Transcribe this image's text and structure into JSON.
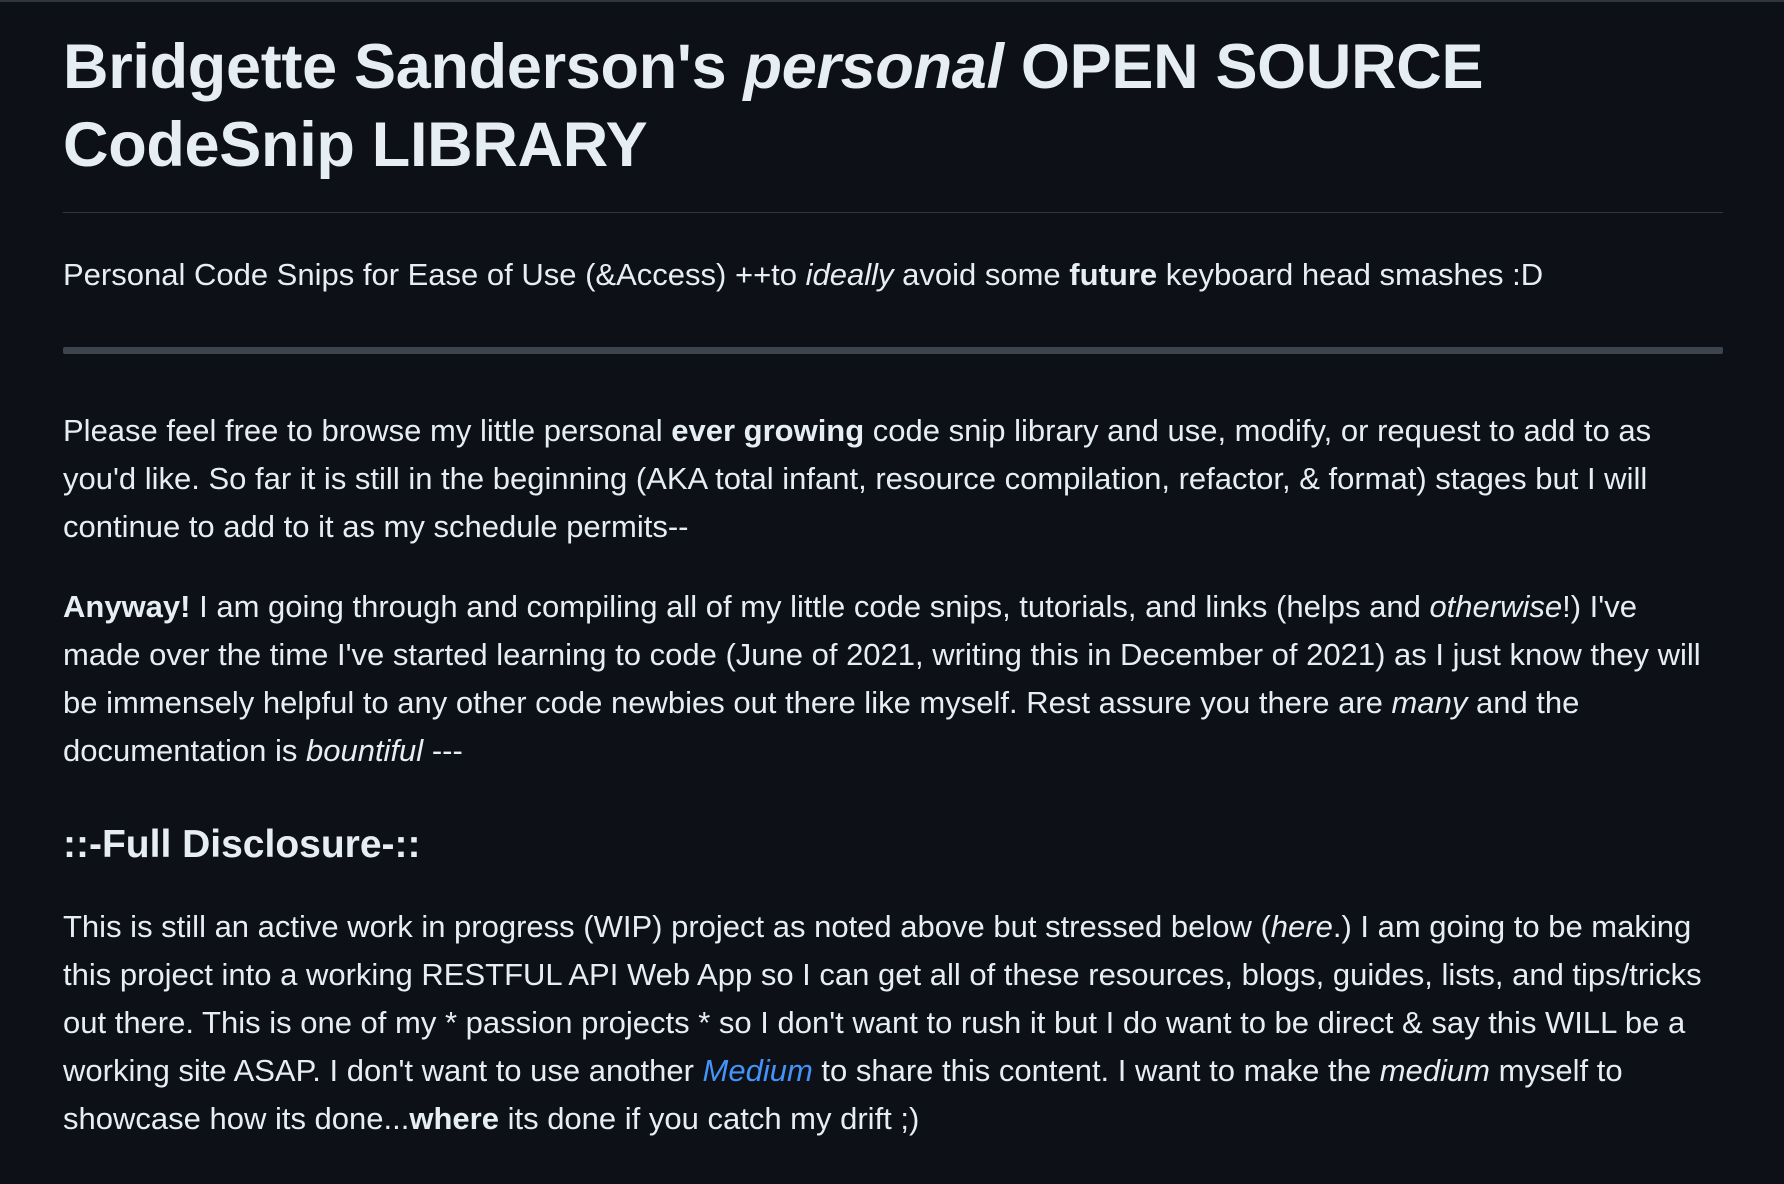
{
  "title": {
    "part1": "Bridgette Sanderson's ",
    "em": "personal",
    "part2": " OPEN SOURCE CodeSnip LIBRARY"
  },
  "tagline": {
    "t1": "Personal Code Snips for Ease of Use (&Access) ++to ",
    "em": "ideally",
    "t2": " avoid some ",
    "strong": "future",
    "t3": " keyboard head smashes :D"
  },
  "intro": {
    "t1": "Please feel free to browse my little personal ",
    "strong": "ever growing",
    "t2": " code snip library and use, modify, or request to add to as you'd like. So far it is still in the beginning (AKA total infant, resource compilation, refactor, & format) stages but I will continue to add to it as my schedule permits--"
  },
  "anyway": {
    "strong": "Anyway!",
    "t1": " I am going through and compiling all of my little code snips, tutorials, and links (helps and ",
    "em1": "otherwise",
    "t2": "!) I've made over the time I've started learning to code (June of 2021, writing this in December of 2021) as I just know they will be immensely helpful to any other code newbies out there like myself. Rest assure you there are ",
    "em2": "many",
    "t3": " and the documentation is ",
    "em3": "bountiful",
    "t4": " ---"
  },
  "disclosure": {
    "heading": "::-Full Disclosure-::",
    "t1": "This is still an active work in progress (WIP) project as noted above but stressed below (",
    "em1": "here",
    "t2": ".) I am going to be making this project into a working RESTFUL API Web App so I can get all of these resources, blogs, guides, lists, and tips/tricks out there. This is one of my * passion projects * so I don't want to rush it but I do want to be direct & say this WILL be a working site ASAP. I don't want to use another ",
    "link": "Medium",
    "t3": " to share this content. I want to make the ",
    "em2": "medium",
    "t4": " myself to showcase how its done...",
    "strong": "where",
    "t5": " its done if you catch my drift ;)"
  },
  "colors": {
    "background": "#0d1117",
    "text": "#e6edf3",
    "link": "#4493f8",
    "rule": "#30363d"
  }
}
